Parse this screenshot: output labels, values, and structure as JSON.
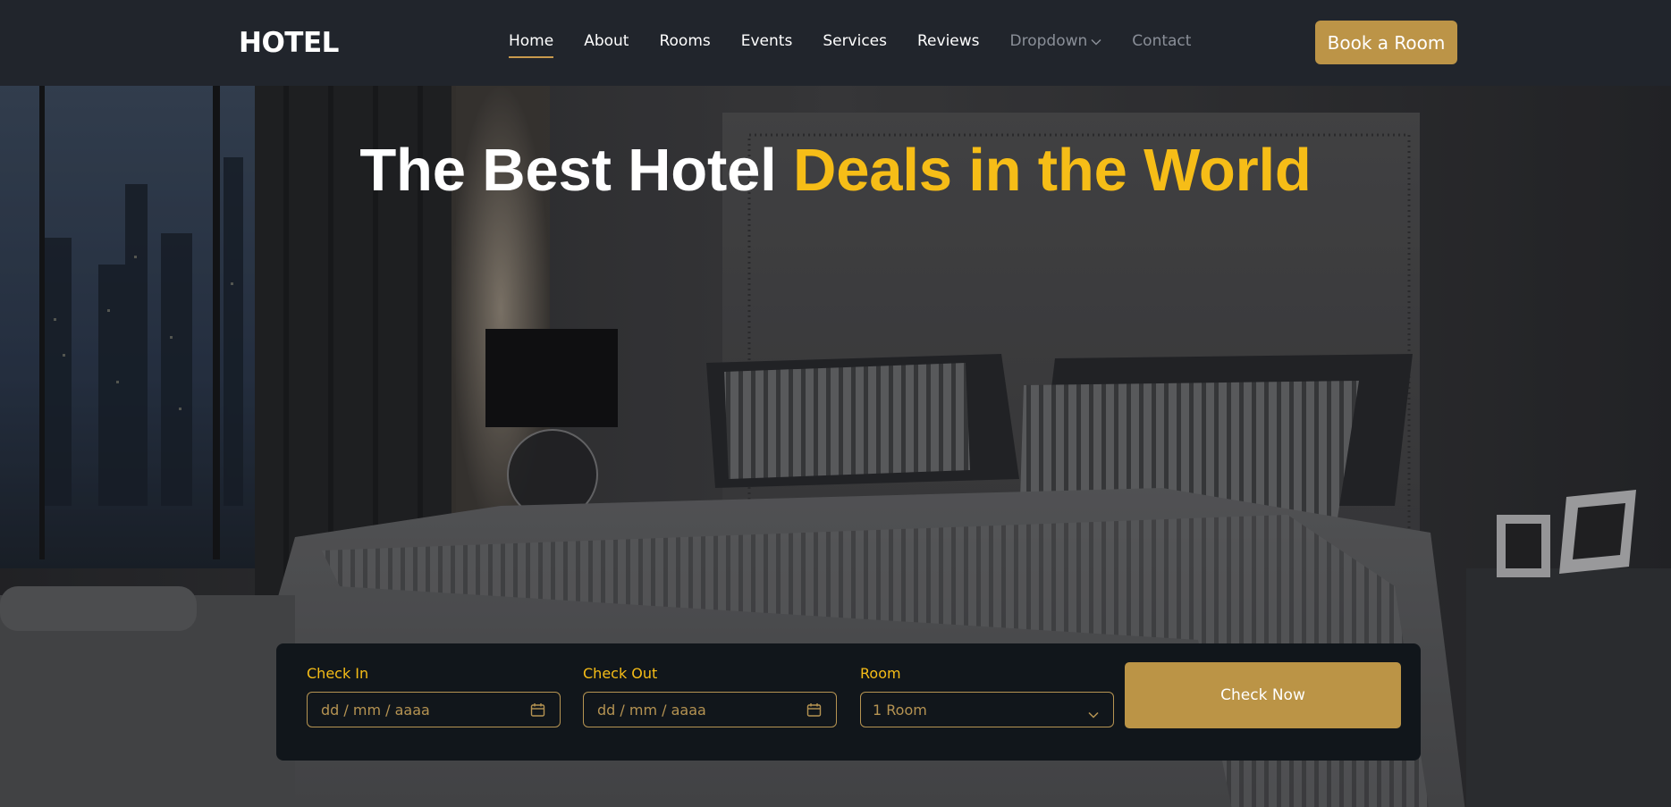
{
  "brand": "HOTEL",
  "nav": {
    "items": [
      {
        "label": "Home"
      },
      {
        "label": "About"
      },
      {
        "label": "Rooms"
      },
      {
        "label": "Events"
      },
      {
        "label": "Services"
      },
      {
        "label": "Reviews"
      },
      {
        "label": "Dropdown"
      },
      {
        "label": "Contact"
      }
    ],
    "active": "Home",
    "book_label": "Book a Room"
  },
  "hero": {
    "title_white": "The Best Hotel",
    "title_highlight": "Deals in the World"
  },
  "booking": {
    "check_in": {
      "label": "Check In",
      "value": "dd / mm / aaaa"
    },
    "check_out": {
      "label": "Check Out",
      "value": "dd / mm / aaaa"
    },
    "room": {
      "label": "Room",
      "value": "1 Room"
    },
    "submit_label": "Check Now"
  },
  "colors": {
    "accent_gold": "#bc9447",
    "highlight_yellow": "#f6bd17",
    "navbar_bg": "#21252c",
    "panel_bg": "#11161b"
  },
  "icons": [
    "calendar-icon",
    "chevron-down-icon"
  ]
}
